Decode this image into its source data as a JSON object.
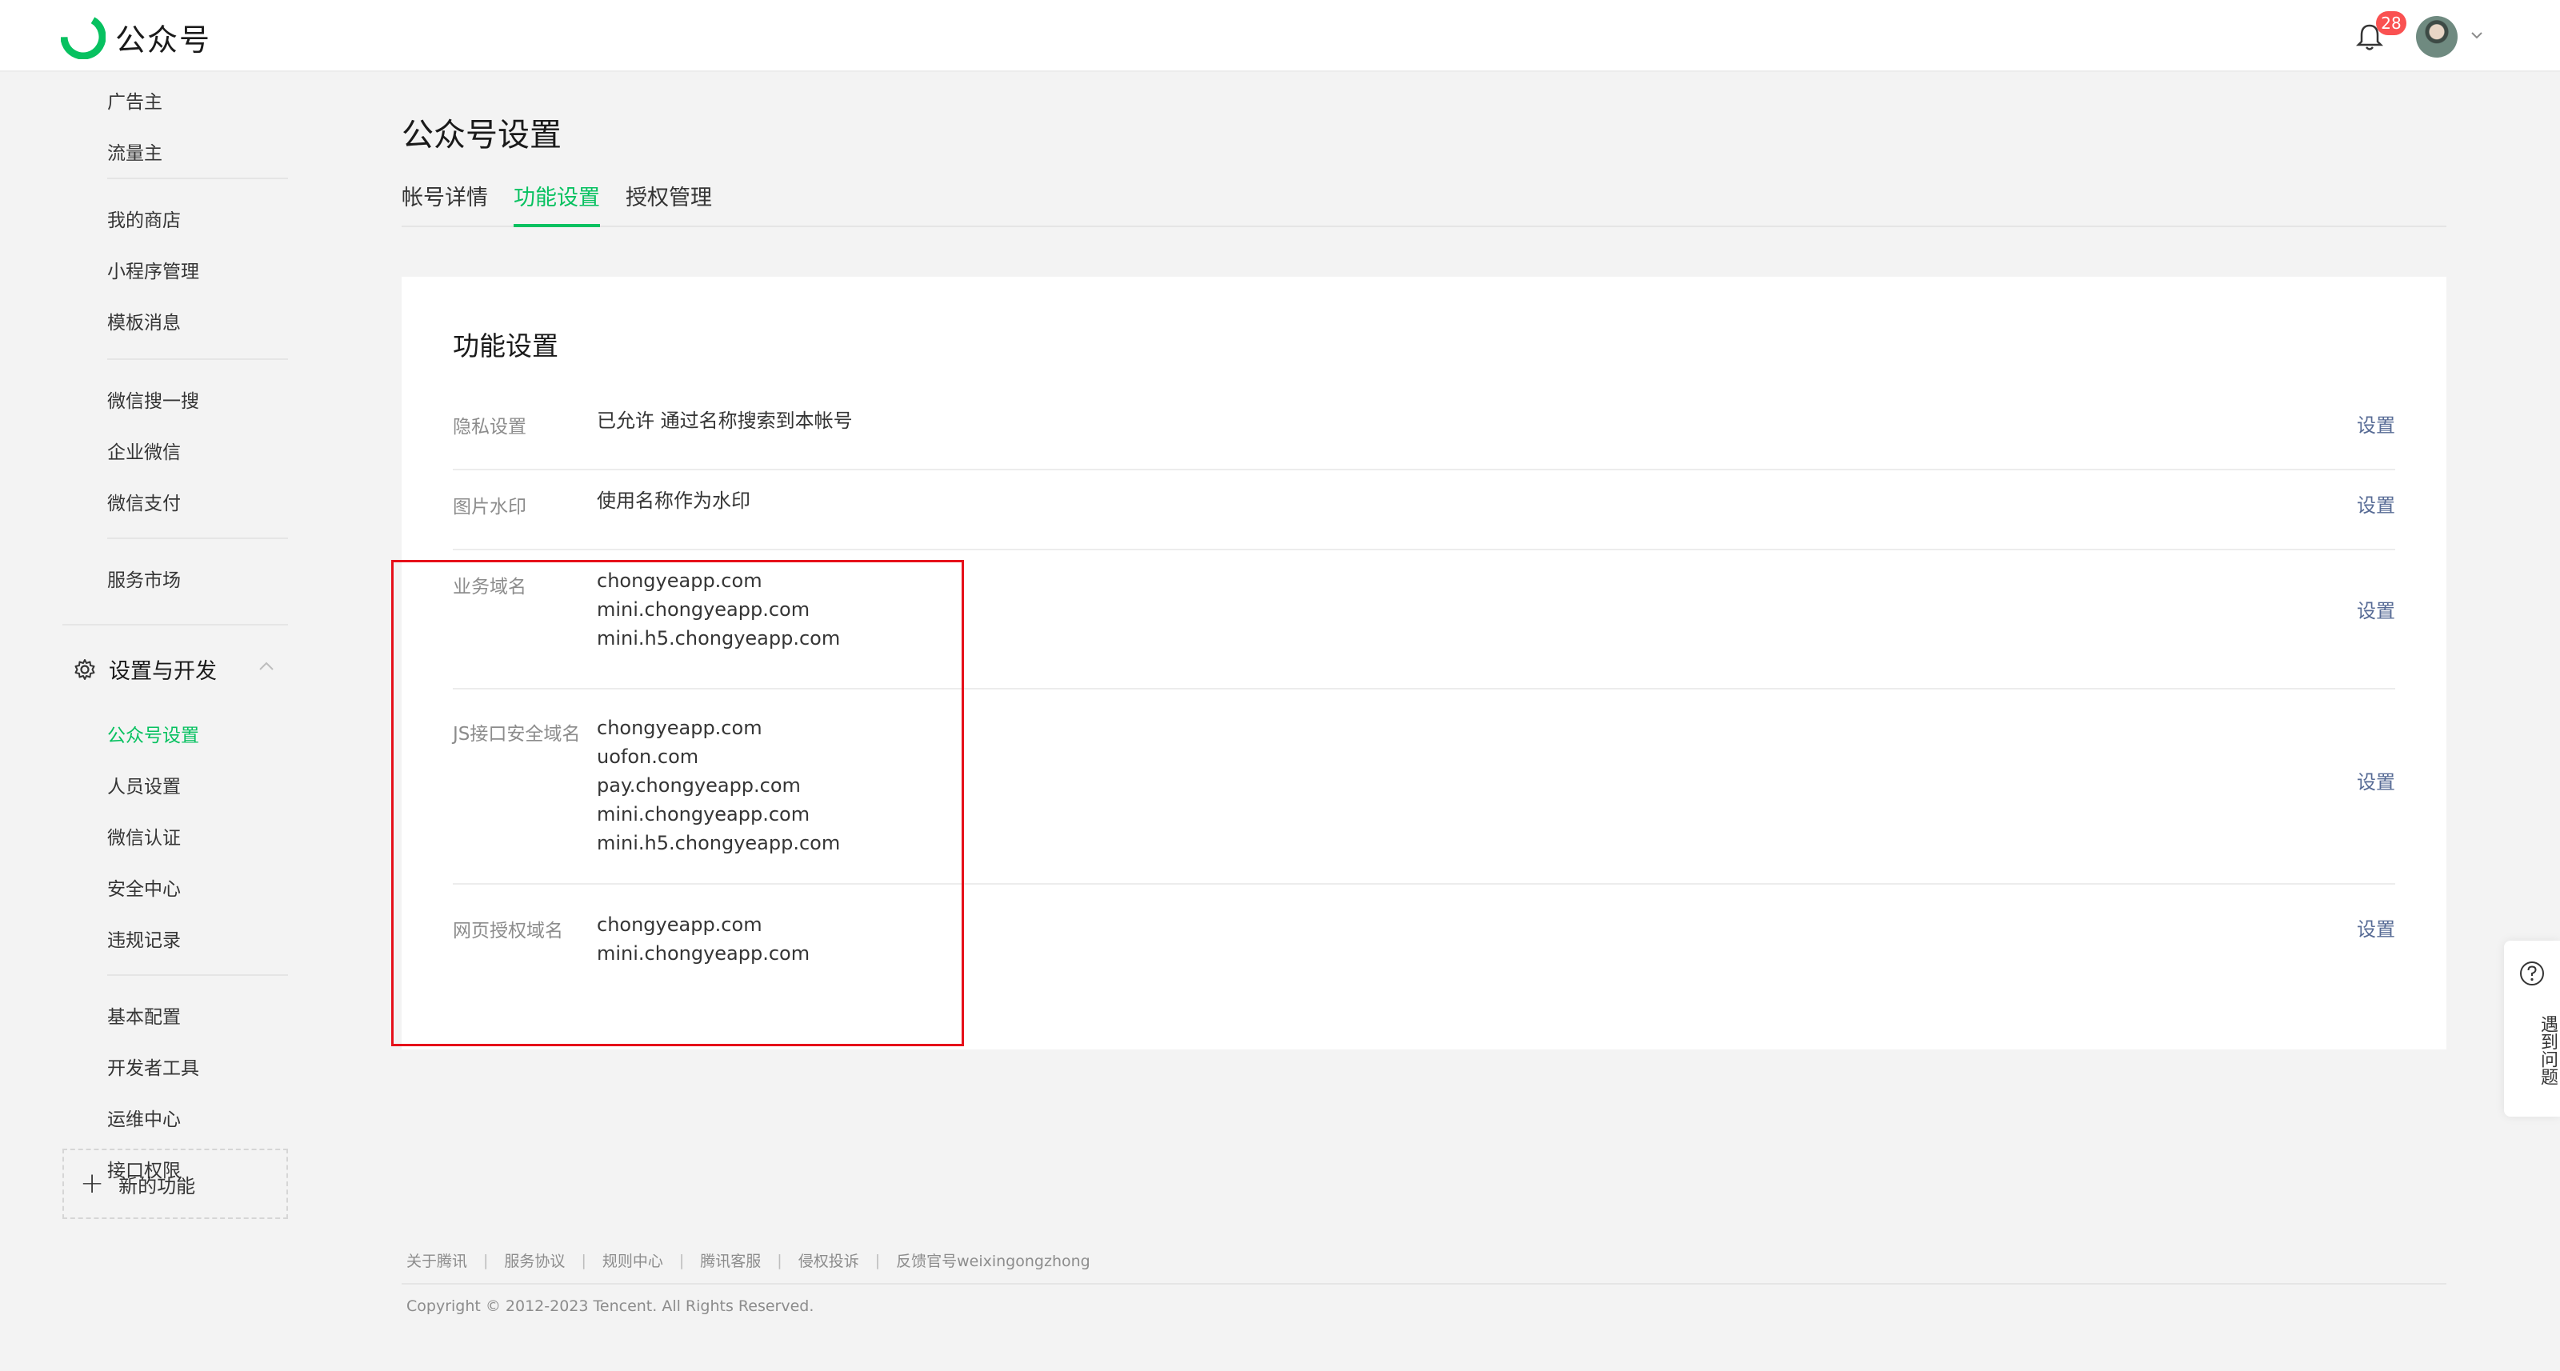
{
  "app": {
    "name": "公众号"
  },
  "header": {
    "notification_count": "28"
  },
  "sidebar": {
    "items": [
      {
        "label": "广告主"
      },
      {
        "label": "流量主"
      },
      {
        "label": "我的商店"
      },
      {
        "label": "小程序管理"
      },
      {
        "label": "模板消息"
      },
      {
        "label": "微信搜一搜"
      },
      {
        "label": "企业微信"
      },
      {
        "label": "微信支付"
      },
      {
        "label": "服务市场"
      }
    ],
    "group_title": "设置与开发",
    "group_items": [
      {
        "label": "公众号设置",
        "active": true
      },
      {
        "label": "人员设置"
      },
      {
        "label": "微信认证"
      },
      {
        "label": "安全中心"
      },
      {
        "label": "违规记录"
      },
      {
        "label": "基本配置"
      },
      {
        "label": "开发者工具"
      },
      {
        "label": "运维中心"
      },
      {
        "label": "接口权限"
      }
    ],
    "new_function": "新的功能"
  },
  "main": {
    "page_title": "公众号设置",
    "tabs": [
      {
        "label": "帐号详情"
      },
      {
        "label": "功能设置",
        "active": true
      },
      {
        "label": "授权管理"
      }
    ],
    "card": {
      "title": "功能设置",
      "rows": [
        {
          "label": "隐私设置",
          "values": [
            "已允许 通过名称搜索到本帐号"
          ],
          "action": "设置"
        },
        {
          "label": "图片水印",
          "values": [
            "使用名称作为水印"
          ],
          "action": "设置"
        },
        {
          "label": "业务域名",
          "values": [
            "chongyeapp.com",
            "mini.chongyeapp.com",
            "mini.h5.chongyeapp.com"
          ],
          "action": "设置"
        },
        {
          "label": "JS接口安全域名",
          "values": [
            "chongyeapp.com",
            "uofon.com",
            "pay.chongyeapp.com",
            "mini.chongyeapp.com",
            "mini.h5.chongyeapp.com"
          ],
          "action": "设置"
        },
        {
          "label": "网页授权域名",
          "values": [
            "chongyeapp.com",
            "mini.chongyeapp.com"
          ],
          "action": "设置"
        }
      ]
    }
  },
  "footer": {
    "links": [
      "关于腾讯",
      "服务协议",
      "规则中心",
      "腾讯客服",
      "侵权投诉",
      "反馈官号weixingongzhong"
    ],
    "separator": "|",
    "copyright": "Copyright © 2012-2023 Tencent. All Rights Reserved."
  },
  "help": {
    "label": "遇到问题"
  },
  "colors": {
    "accent": "#07c160",
    "link": "#576b95",
    "highlight": "#e6101a",
    "badge": "#fa5151"
  }
}
